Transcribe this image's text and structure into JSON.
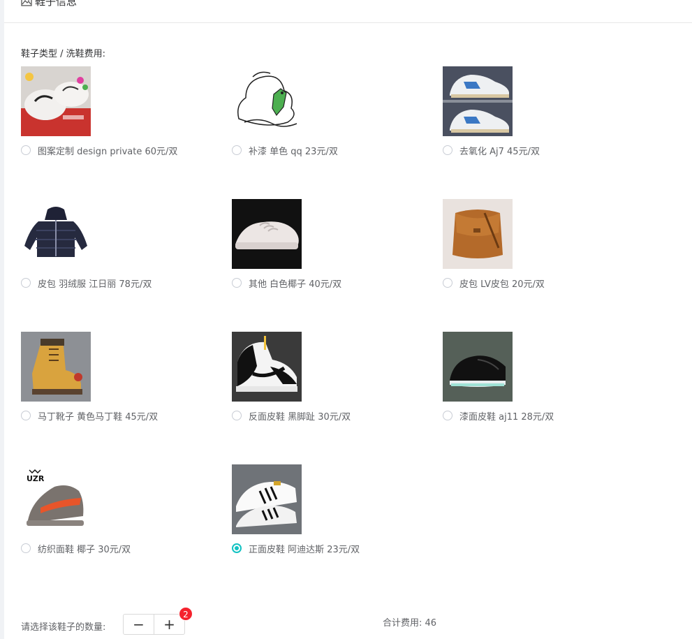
{
  "header": {
    "title": "鞋子信息",
    "icon": "image-icon"
  },
  "section_label": "鞋子类型 / 洗鞋费用:",
  "options": [
    {
      "label": "图案定制 design private 60元/双",
      "checked": false,
      "image": "painted-sneakers"
    },
    {
      "label": "补漆 单色 qq 23元/双",
      "checked": false,
      "image": "sketch-logo"
    },
    {
      "label": "去氧化 Aj7 45元/双",
      "checked": false,
      "image": "two-sneakers"
    },
    {
      "label": "皮包 羽绒服 江日丽 78元/双",
      "checked": false,
      "image": "down-jacket"
    },
    {
      "label": "其他 白色椰子 40元/双",
      "checked": false,
      "image": "white-yeezy"
    },
    {
      "label": "皮包 LV皮包 20元/双",
      "checked": false,
      "image": "leather-bag"
    },
    {
      "label": "马丁靴子 黄色马丁鞋 45元/双",
      "checked": false,
      "image": "yellow-boot"
    },
    {
      "label": "反面皮鞋 黑脚趾 30元/双",
      "checked": false,
      "image": "jordan-black-toe"
    },
    {
      "label": "漆面皮鞋 aj11 28元/双",
      "checked": false,
      "image": "aj11"
    },
    {
      "label": "纺织面鞋 椰子 30元/双",
      "checked": false,
      "image": "uzr-yeezy"
    },
    {
      "label": "正面皮鞋 阿迪达斯 23元/双",
      "checked": true,
      "image": "adidas-superstar"
    }
  ],
  "uzr_logo_text": "UZR",
  "quantity": {
    "label": "请选择该鞋子的数量:",
    "minus": "−",
    "plus": "+",
    "value": "2"
  },
  "total": {
    "text": "合计费用: 46"
  },
  "colors": {
    "accent": "#13c2c2",
    "badge": "#f5222d"
  }
}
